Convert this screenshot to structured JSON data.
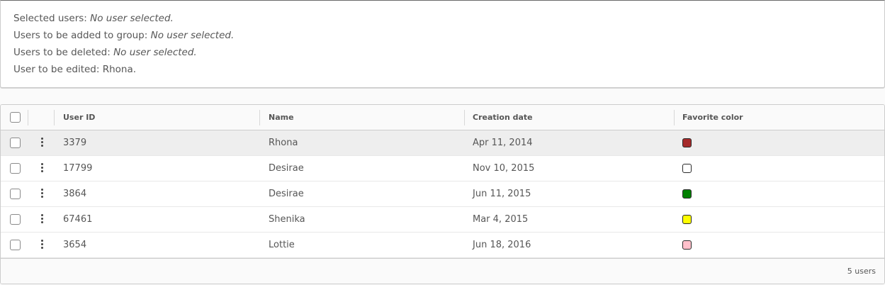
{
  "info": {
    "selected_label": "Selected users:",
    "selected_value": "No user selected.",
    "add_group_label": "Users to be added to group:",
    "add_group_value": "No user selected.",
    "delete_label": "Users to be deleted:",
    "delete_value": "No user selected.",
    "edit_label": "User to be edited:",
    "edit_value": "Rhona."
  },
  "grid": {
    "columns": {
      "user_id": "User ID",
      "name": "Name",
      "creation_date": "Creation date",
      "favorite_color": "Favorite color"
    },
    "rows": [
      {
        "user_id": "3379",
        "name": "Rhona",
        "creation_date": "Apr 11, 2014",
        "color": "#a52a2a",
        "selected": true
      },
      {
        "user_id": "17799",
        "name": "Desirae",
        "creation_date": "Nov 10, 2015",
        "color": "#ffffff",
        "selected": false
      },
      {
        "user_id": "3864",
        "name": "Desirae",
        "creation_date": "Jun 11, 2015",
        "color": "#008000",
        "selected": false
      },
      {
        "user_id": "67461",
        "name": "Shenika",
        "creation_date": "Mar 4, 2015",
        "color": "#ffff00",
        "selected": false
      },
      {
        "user_id": "3654",
        "name": "Lottie",
        "creation_date": "Jun 18, 2016",
        "color": "#ffc0cb",
        "selected": false
      }
    ],
    "footer_count": "5 users"
  }
}
